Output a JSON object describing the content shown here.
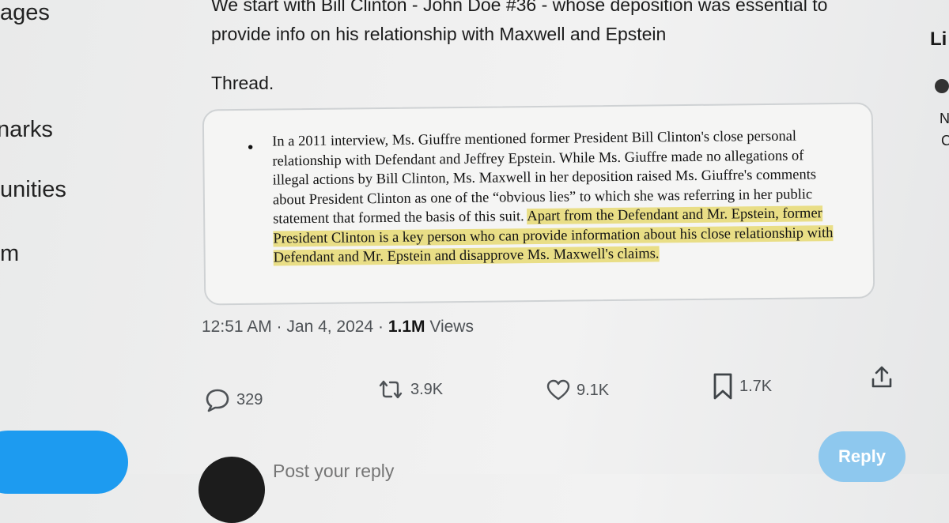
{
  "left_nav": {
    "items": [
      {
        "label": "ages"
      },
      {
        "label": "narks"
      },
      {
        "label": "unities"
      },
      {
        "label": "m"
      }
    ]
  },
  "tweet": {
    "text": "We start with Bill Clinton - John Doe #36 - whose deposition was essential to provide info on his relationship with Maxwell and Epstein",
    "thread_label": "Thread.",
    "quote": {
      "text_plain": "In a 2011 interview, Ms. Giuffre mentioned former President Bill Clinton's close personal relationship with Defendant and Jeffrey Epstein.  While Ms. Giuffre made no allegations of illegal actions by Bill Clinton, Ms. Maxwell in her deposition raised Ms. Giuffre's comments about President Clinton as one of the “obvious lies” to which she was referring in her public statement that formed the basis of this suit. ",
      "text_highlight": " Apart from the Defendant and Mr. Epstein, former President Clinton is a key person who can provide information about his close relationship with Defendant and Mr. Epstein and disapprove Ms. Maxwell's claims."
    },
    "meta": {
      "time_date": "12:51 AM · Jan 4, 2024 · ",
      "views_count": "1.1M",
      "views_label": " Views"
    },
    "actions": {
      "replies": "329",
      "retweets": "3.9K",
      "likes": "9.1K",
      "bookmarks": "1.7K"
    }
  },
  "composer": {
    "placeholder": "Post your reply",
    "reply_label": "Reply"
  },
  "right_column": {
    "title": "Li",
    "letter1": "N",
    "letter2": "C"
  },
  "colors": {
    "accent": "#1d9bf0",
    "highlight": "#e9de86",
    "reply_button": "#8ec8ee"
  }
}
